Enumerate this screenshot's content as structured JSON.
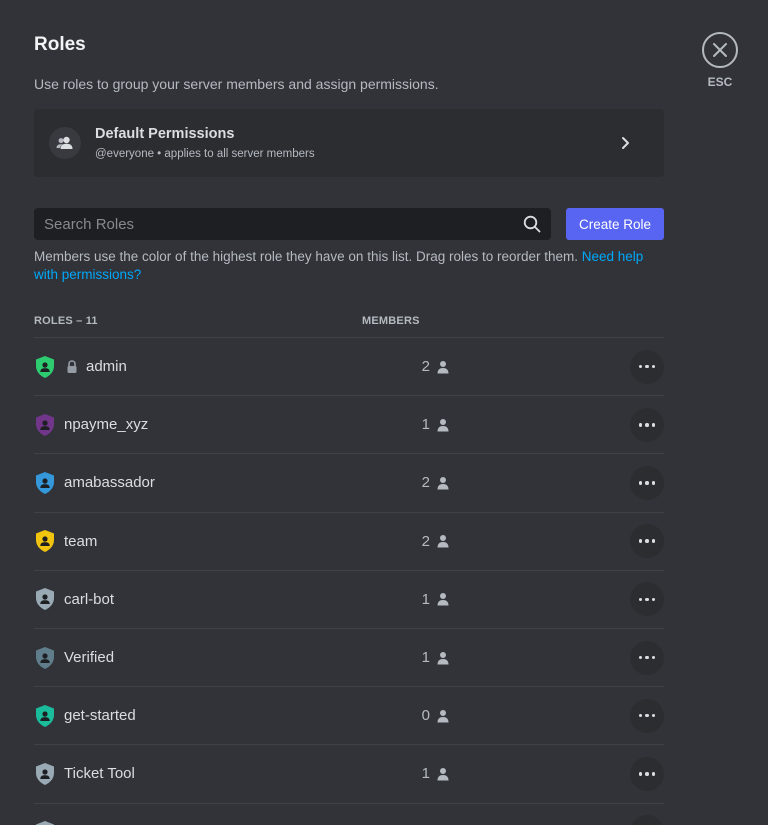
{
  "header": {
    "title": "Roles",
    "description": "Use roles to group your server members and assign permissions.",
    "esc_label": "ESC"
  },
  "default_permissions": {
    "title": "Default Permissions",
    "subtitle": "@everyone • applies to all server members"
  },
  "search": {
    "placeholder": "Search Roles",
    "value": ""
  },
  "create_button": "Create Role",
  "help": {
    "text": "Members use the color of the highest role they have on this list. Drag roles to reorder them. ",
    "link": "Need help with permissions?"
  },
  "columns": {
    "roles": "ROLES – 11",
    "members": "MEMBERS"
  },
  "roles": [
    {
      "name": "admin",
      "members": "2",
      "color": "#2ecc71",
      "locked": true
    },
    {
      "name": "npayme_xyz",
      "members": "1",
      "color": "#71368a",
      "locked": false
    },
    {
      "name": "amabassador",
      "members": "2",
      "color": "#3498db",
      "locked": false
    },
    {
      "name": "team",
      "members": "2",
      "color": "#f1c40f",
      "locked": false
    },
    {
      "name": "carl-bot",
      "members": "1",
      "color": "#99aab5",
      "locked": false
    },
    {
      "name": "Verified",
      "members": "1",
      "color": "#607d8b",
      "locked": false
    },
    {
      "name": "get-started",
      "members": "0",
      "color": "#1abc9c",
      "locked": false
    },
    {
      "name": "Ticket Tool",
      "members": "1",
      "color": "#99aab5",
      "locked": false
    },
    {
      "name": "",
      "members": "",
      "color": "#99aab5",
      "locked": false
    }
  ],
  "colors": {
    "background": "#313338",
    "accent": "#5865f2",
    "link": "#00a8fc"
  },
  "icons": {
    "close": "close-icon",
    "chevron": "chevron-right-icon",
    "search": "search-icon",
    "member": "person-icon",
    "lock": "lock-icon",
    "more": "more-dots-icon",
    "shield": "role-shield-icon"
  }
}
